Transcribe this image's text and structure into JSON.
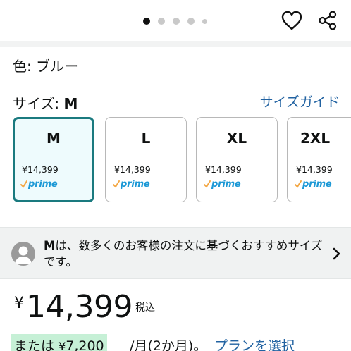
{
  "carousel": {
    "dot_count": 5,
    "active_index": 0
  },
  "header": {
    "favorite_icon": "heart-icon",
    "share_icon": "share-icon"
  },
  "color": {
    "label": "色: ブルー"
  },
  "size": {
    "label_prefix": "サイズ: ",
    "selected": "M",
    "guide_link": "サイズガイド"
  },
  "sizes": [
    {
      "label": "M",
      "price": "¥14,399",
      "prime": "prime",
      "selected": true
    },
    {
      "label": "L",
      "price": "¥14,399",
      "prime": "prime",
      "selected": false
    },
    {
      "label": "XL",
      "price": "¥14,399",
      "prime": "prime",
      "selected": false
    },
    {
      "label": "2XL",
      "price": "¥14,399",
      "prime": "prime",
      "selected": false
    }
  ],
  "recommendation": {
    "size": "M",
    "text": "は、数多くのお客様の注文に基づくおすすめサイズです。",
    "avatar_icon": "user-avatar-icon",
    "chevron_icon": "chevron-right-icon"
  },
  "price": {
    "currency": "¥",
    "amount": "14,399",
    "tax_note": "税込"
  },
  "installment": {
    "prefix": "または",
    "currency": "¥",
    "amount": "7,200",
    "period": "/月(2か月)。",
    "link": "プランを選択"
  },
  "colors": {
    "accent_teal": "#1a7a7f",
    "selected_bg": "#eefbfd",
    "link_blue": "#2162a1",
    "prime_blue": "#1d99d6",
    "prime_check_orange": "#f3a847",
    "installment_highlight": "#c6f0d6"
  }
}
